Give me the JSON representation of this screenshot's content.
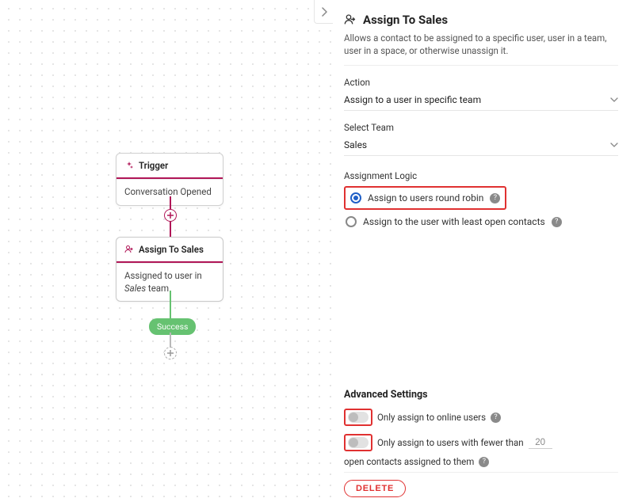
{
  "canvas": {
    "trigger": {
      "title": "Trigger",
      "desc": "Conversation Opened"
    },
    "assign": {
      "title": "Assign To Sales",
      "desc_prefix": "Assigned to user in ",
      "desc_em": "Sales",
      "desc_suffix": " team"
    },
    "success_label": "Success"
  },
  "panel": {
    "title": "Assign To Sales",
    "description": "Allows a contact to be assigned to a specific user, user in a team, user in a space, or otherwise unassign it.",
    "action_label": "Action",
    "action_value": "Assign to a user in specific team",
    "team_label": "Select Team",
    "team_value": "Sales",
    "logic_label": "Assignment Logic",
    "logic_opt_round_robin": "Assign to users round robin",
    "logic_opt_least_open": "Assign to the user with least open contacts",
    "advanced_label": "Advanced Settings",
    "online_only_label": "Only assign to online users",
    "fewer_prefix": "Only assign to users with fewer than",
    "fewer_value": "20",
    "fewer_suffix": "open contacts assigned to them",
    "delete_label": "DELETE"
  }
}
